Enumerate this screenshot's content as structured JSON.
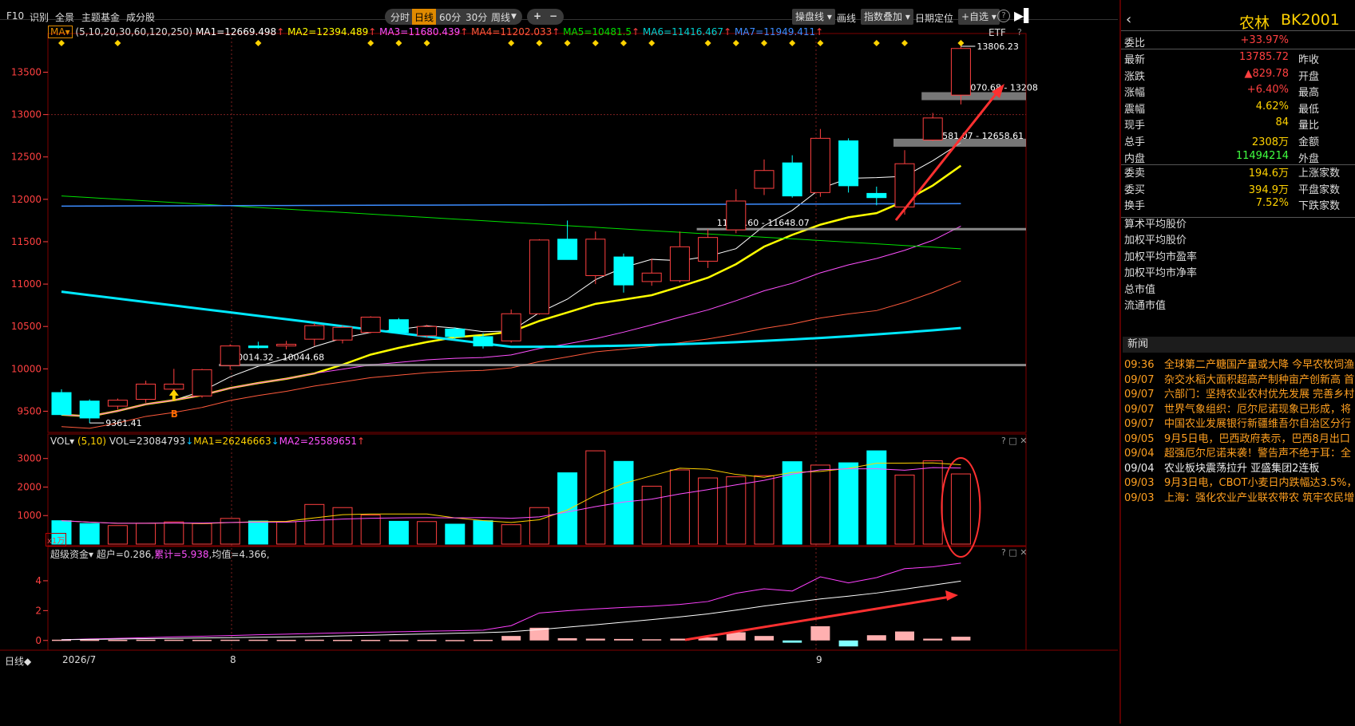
{
  "toolbar": {
    "left_items": [
      "F10",
      "识别",
      "全景",
      "主题基金",
      "成分股"
    ],
    "period_tabs": [
      "分时",
      "日线",
      "60分",
      "30分",
      "周线"
    ],
    "active_period": "日线",
    "right_items": [
      "操盘线",
      "画线",
      "指数叠加",
      "日期定位",
      "+自选"
    ],
    "help": "?"
  },
  "main_legend": {
    "ma_select": "MA",
    "params": "(5,10,20,30,60,120,250)",
    "items": [
      {
        "text": "MA1=12669.498",
        "color": "#ffffff",
        "arrow": "↑"
      },
      {
        "text": "MA2=12394.489",
        "color": "#ffff00",
        "arrow": "↑"
      },
      {
        "text": "MA3=11680.439",
        "color": "#ff50ff",
        "arrow": "↑"
      },
      {
        "text": "MA4=11202.033",
        "color": "#ff5a3c",
        "arrow": "↑"
      },
      {
        "text": "MA5=10481.5",
        "color": "#00e000",
        "arrow": "↑"
      },
      {
        "text": "MA6=11416.467",
        "color": "#00d0d0",
        "arrow": "↑"
      },
      {
        "text": "MA7=11949.411",
        "color": "#3c8cff",
        "arrow": "↑"
      }
    ],
    "etf": "ETF",
    "help": "?"
  },
  "vol_legend": {
    "name": "VOL",
    "params": "(5,10)",
    "vol": "VOL=23084793",
    "ma1": "MA1=26246663",
    "ma2": "MA2=25589651",
    "scale": "x1万"
  },
  "fund_legend": {
    "name": "超级资金",
    "chao": "超户=0.286",
    "lei": "累计=5.938",
    "jun": "均值=4.366"
  },
  "bottom": {
    "period": "日线",
    "date_labels": [
      "2026/7",
      "8",
      "9"
    ]
  },
  "chart_data": {
    "type": "candlestick",
    "y_ticks": [
      9500,
      10000,
      10500,
      11000,
      11500,
      12000,
      12500,
      13000,
      13500
    ],
    "ylim": [
      9250,
      13900
    ],
    "candles": [
      {
        "o": 9720,
        "h": 9760,
        "l": 9450,
        "c": 9460
      },
      {
        "o": 9620,
        "h": 9640,
        "l": 9361.41,
        "c": 9420
      },
      {
        "o": 9560,
        "h": 9650,
        "l": 9520,
        "c": 9630
      },
      {
        "o": 9640,
        "h": 9860,
        "l": 9600,
        "c": 9820
      },
      {
        "o": 9760,
        "h": 10000,
        "l": 9720,
        "c": 9820
      },
      {
        "o": 9680,
        "h": 10000,
        "l": 9660,
        "c": 9990
      },
      {
        "o": 10040,
        "h": 10290,
        "l": 9990,
        "c": 10270
      },
      {
        "o": 10270,
        "h": 10320,
        "l": 10240,
        "c": 10250
      },
      {
        "o": 10270,
        "h": 10330,
        "l": 10230,
        "c": 10290
      },
      {
        "o": 10350,
        "h": 10540,
        "l": 10270,
        "c": 10510
      },
      {
        "o": 10340,
        "h": 10510,
        "l": 10300,
        "c": 10490
      },
      {
        "o": 10430,
        "h": 10620,
        "l": 10420,
        "c": 10610
      },
      {
        "o": 10580,
        "h": 10600,
        "l": 10420,
        "c": 10430
      },
      {
        "o": 10390,
        "h": 10520,
        "l": 10370,
        "c": 10500
      },
      {
        "o": 10470,
        "h": 10490,
        "l": 10350,
        "c": 10380
      },
      {
        "o": 10380,
        "h": 10420,
        "l": 10240,
        "c": 10270
      },
      {
        "o": 10330,
        "h": 10700,
        "l": 10310,
        "c": 10650
      },
      {
        "o": 10650,
        "h": 11530,
        "l": 10640,
        "c": 11520
      },
      {
        "o": 11530,
        "h": 11750,
        "l": 11350,
        "c": 11290
      },
      {
        "o": 11100,
        "h": 11620,
        "l": 11000,
        "c": 11530
      },
      {
        "o": 11320,
        "h": 11360,
        "l": 10900,
        "c": 10990
      },
      {
        "o": 11030,
        "h": 11300,
        "l": 10980,
        "c": 11130
      },
      {
        "o": 11040,
        "h": 11620,
        "l": 11020,
        "c": 11440
      },
      {
        "o": 11270,
        "h": 11648.07,
        "l": 11190,
        "c": 11550
      },
      {
        "o": 11640,
        "h": 12120,
        "l": 11600,
        "c": 11980
      },
      {
        "o": 12130,
        "h": 12470,
        "l": 12050,
        "c": 12340
      },
      {
        "o": 12430,
        "h": 12520,
        "l": 12020,
        "c": 12040
      },
      {
        "o": 12080,
        "h": 12830,
        "l": 12030,
        "c": 12720
      },
      {
        "o": 12690,
        "h": 12720,
        "l": 12080,
        "c": 12160
      },
      {
        "o": 12070,
        "h": 12150,
        "l": 11930,
        "c": 12020
      },
      {
        "o": 11910,
        "h": 12580,
        "l": 11820,
        "c": 12420
      },
      {
        "o": 12700,
        "h": 13020,
        "l": 12690,
        "c": 12960
      },
      {
        "o": 13230,
        "h": 13806.23,
        "l": 13120,
        "c": 13780
      }
    ],
    "annotations": {
      "low": "9361.41",
      "high": "13806.23",
      "gap1": "10014.32 - 10044.68",
      "gap2": "11636.60 - 11648.07",
      "gap3": "12581.07 - 12658.61",
      "gap4": "13070.68 - 13208",
      "b_label": "B"
    },
    "gap_lines": [
      10044.68,
      11648.07,
      12658.61,
      13208
    ],
    "volume": {
      "y_ticks": [
        1000,
        2000,
        3000
      ],
      "ylim": [
        0,
        3300
      ],
      "values": [
        820,
        720,
        650,
        730,
        780,
        720,
        900,
        810,
        780,
        1390,
        1280,
        1020,
        800,
        790,
        700,
        820,
        680,
        1280,
        2500,
        3270,
        2900,
        2030,
        2600,
        2320,
        2360,
        2400,
        2890,
        2770,
        2850,
        3270,
        2420,
        2920,
        2460
      ]
    },
    "fund": {
      "y_ticks": [
        0,
        2,
        4
      ],
      "ylim": [
        -0.6,
        5.6
      ],
      "bars": [
        0.05,
        0.05,
        0.04,
        0.05,
        0.05,
        0.04,
        0.05,
        0.05,
        0.04,
        0.05,
        0.04,
        0.04,
        0.03,
        0.04,
        0.03,
        0.04,
        0.3,
        0.85,
        0.15,
        0.12,
        0.1,
        0.08,
        0.12,
        0.2,
        0.55,
        0.3,
        -0.15,
        0.95,
        -0.4,
        0.35,
        0.6,
        0.12,
        0.25
      ]
    }
  },
  "right_panel": {
    "name": "农林",
    "code": "BK2001",
    "weibi_label": "委比",
    "weibi": "+33.97%",
    "quotes": [
      {
        "k": "最新",
        "v": "13785.72",
        "color": "#ff4040",
        "k2": "昨收"
      },
      {
        "k": "涨跌",
        "v": "▲829.78",
        "color": "#ff4040",
        "k2": "开盘"
      },
      {
        "k": "涨幅",
        "v": "+6.40%",
        "color": "#ff4040",
        "k2": "最高"
      },
      {
        "k": "震幅",
        "v": "4.62%",
        "color": "#ffd200",
        "k2": "最低"
      },
      {
        "k": "现手",
        "v": "84",
        "color": "#ffd200",
        "k2": "量比"
      },
      {
        "k": "总手",
        "v": "2308万",
        "color": "#ffd200",
        "k2": "金额"
      },
      {
        "k": "内盘",
        "v": "11494214",
        "color": "#40ff40",
        "k2": "外盘"
      }
    ],
    "quotes2": [
      {
        "k": "委卖",
        "v": "194.6万",
        "color": "#ffd200",
        "k2": "上涨家数"
      },
      {
        "k": "委买",
        "v": "394.9万",
        "color": "#ffd200",
        "k2": "平盘家数"
      },
      {
        "k": "换手",
        "v": "7.52%",
        "color": "#ffd200",
        "k2": "下跌家数"
      }
    ],
    "groups": [
      "算术平均股价",
      "加权平均股价",
      "加权平均市盈率",
      "加权平均市净率",
      "总市值",
      "流通市值"
    ],
    "news_title": "新闻",
    "news": [
      {
        "t": "09:36",
        "s": "全球第二产糖国产量或大降 今早农牧饲渔"
      },
      {
        "t": "09/07",
        "s": "杂交水稻大面积超高产制种亩产创新高 首"
      },
      {
        "t": "09/07",
        "s": "六部门：坚持农业农村优先发展 完善乡村"
      },
      {
        "t": "09/07",
        "s": "世界气象组织：厄尔尼诺现象已形成，将"
      },
      {
        "t": "09/07",
        "s": "中国农业发展银行新疆维吾尔自治区分行"
      },
      {
        "t": "09/05",
        "s": "9月5日电，巴西政府表示，巴西8月出口"
      },
      {
        "t": "09/04",
        "s": "超强厄尔尼诺来袭！警告声不绝于耳：全"
      },
      {
        "t": "09/04",
        "s": "农业板块震荡拉升 亚盛集团2连板",
        "white": true
      },
      {
        "t": "09/03",
        "s": "9月3日电，CBOT小麦日内跌幅达3.5%，"
      },
      {
        "t": "09/03",
        "s": "上海：强化农业产业联农带农 筑牢农民增"
      }
    ]
  }
}
